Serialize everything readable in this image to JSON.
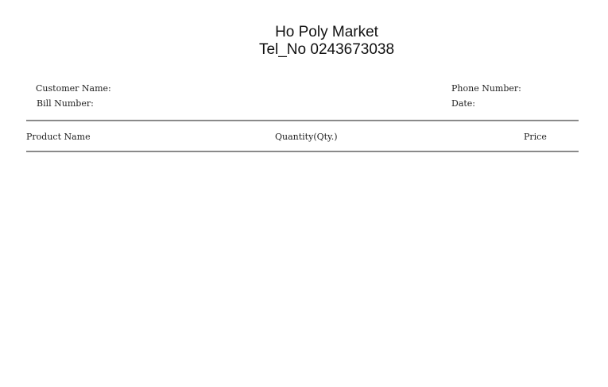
{
  "bill": {
    "store_name": "Ho Poly Market",
    "telephone": "Tel_No 0243673038",
    "fields": {
      "customer_name_label": "Customer Name:",
      "bill_number_label": "Bill Number:",
      "phone_number_label": "Phone Number:",
      "date_label": "Date:"
    },
    "table": {
      "columns": [
        "Product Name",
        "Quantity(Qty.)",
        "Price"
      ],
      "rows": []
    }
  }
}
